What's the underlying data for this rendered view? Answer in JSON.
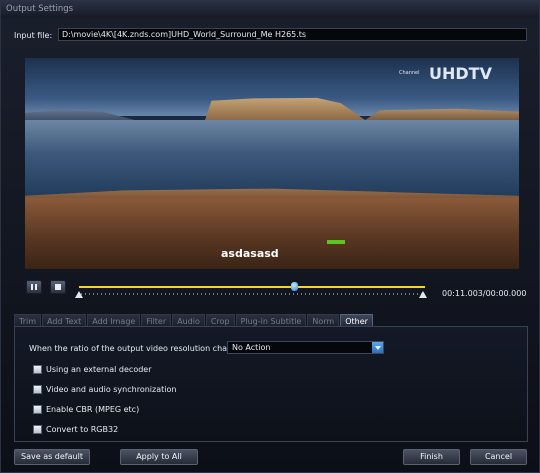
{
  "window": {
    "title": "Output Settings"
  },
  "input": {
    "label": "Input file:",
    "value": "D:\\movie\\4K\\[4K.znds.com]UHD_World_Surround_Me H265.ts"
  },
  "preview": {
    "logo_text": "UHDTV",
    "logo_small": "Channel",
    "subtitle_text": "asdasasd"
  },
  "player": {
    "play_pause_icon": "pause-icon",
    "stop_icon": "stop-icon",
    "time": "00:11.003/00:00.000",
    "progress": 0.62,
    "accent": "#ffd21e"
  },
  "tabs": [
    {
      "label": "Trim",
      "active": false
    },
    {
      "label": "Add Text",
      "active": false
    },
    {
      "label": "Add Image",
      "active": false
    },
    {
      "label": "Filter",
      "active": false
    },
    {
      "label": "Audio",
      "active": false
    },
    {
      "label": "Crop",
      "active": false
    },
    {
      "label": "Plug-in Subtitle",
      "active": false
    },
    {
      "label": "Norm",
      "active": false
    },
    {
      "label": "Other",
      "active": true
    }
  ],
  "other": {
    "ratio_label": "When the ratio of the output video resolution changes :",
    "ratio_value": "No Action",
    "options": [
      {
        "label": "Using an external decoder",
        "checked": false
      },
      {
        "label": "Video and audio synchronization",
        "checked": false
      },
      {
        "label": "Enable CBR (MPEG etc)",
        "checked": false
      },
      {
        "label": "Convert to RGB32",
        "checked": false
      }
    ]
  },
  "buttons": {
    "save_default": "Save as default",
    "apply_all": "Apply to All",
    "finish": "Finish",
    "cancel": "Cancel"
  }
}
